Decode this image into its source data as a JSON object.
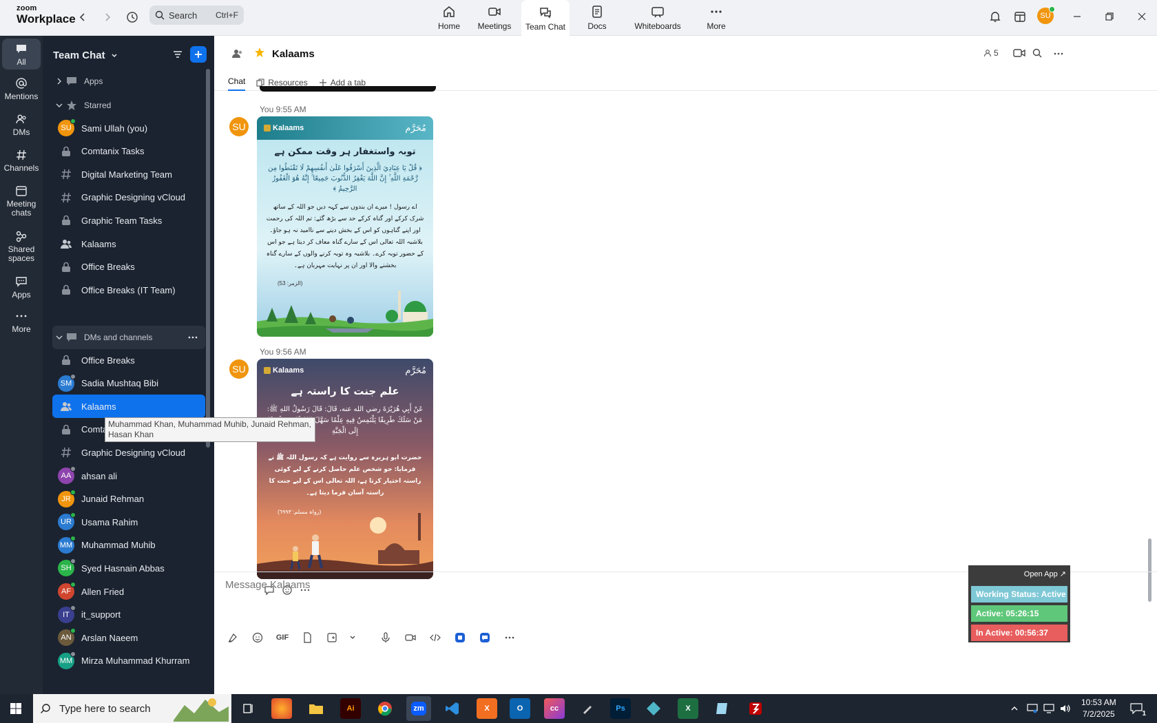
{
  "app": {
    "logo_line1": "zoom",
    "logo_line2": "Workplace"
  },
  "search": {
    "placeholder": "Search",
    "shortcut": "Ctrl+F"
  },
  "top_tabs": [
    {
      "label": "Home",
      "icon": "home-icon"
    },
    {
      "label": "Meetings",
      "icon": "video-icon"
    },
    {
      "label": "Team Chat",
      "icon": "chat-icon",
      "active": true
    },
    {
      "label": "Docs",
      "icon": "doc-icon"
    },
    {
      "label": "Whiteboards",
      "icon": "whiteboard-icon"
    },
    {
      "label": "More",
      "icon": "more-icon"
    }
  ],
  "top_right": {
    "avatar": "SU"
  },
  "rail": [
    {
      "label": "All",
      "icon": "chat-bubble-icon",
      "active": true
    },
    {
      "label": "Mentions",
      "icon": "at-icon"
    },
    {
      "label": "DMs",
      "icon": "people-icon"
    },
    {
      "label": "Channels",
      "icon": "hash-icon"
    },
    {
      "label": "Meeting chats",
      "icon": "calendar-icon"
    },
    {
      "label": "Shared spaces",
      "icon": "spaces-icon"
    },
    {
      "label": "Apps",
      "icon": "apps-icon"
    },
    {
      "label": "More",
      "icon": "ellipsis-icon"
    }
  ],
  "sidebar": {
    "title": "Team Chat",
    "apps_label": "Apps",
    "starred_label": "Starred",
    "starred": [
      {
        "label": "Sami Ullah (you)",
        "type": "avatar",
        "initials": "SU",
        "color": "#f0950d",
        "dot": "#2bb44a"
      },
      {
        "label": "Comtanix Tasks",
        "type": "lock"
      },
      {
        "label": "Digital Marketing Team",
        "type": "hash"
      },
      {
        "label": "Graphic Designing vCloud",
        "type": "hash"
      },
      {
        "label": "Graphic Team Tasks",
        "type": "lock"
      },
      {
        "label": "Kalaams",
        "type": "group"
      },
      {
        "label": "Office Breaks",
        "type": "lock"
      },
      {
        "label": "Office Breaks (IT Team)",
        "type": "lock"
      }
    ],
    "dm_label": "DMs and channels",
    "dms": [
      {
        "label": "Office Breaks",
        "type": "lock"
      },
      {
        "label": "Sadia Mushtaq Bibi",
        "type": "avatar",
        "initials": "SM",
        "color": "#2b7bd1",
        "dot": "#8a8f98"
      },
      {
        "label": "Kalaams",
        "type": "group",
        "active": true
      },
      {
        "label": "Comtanix Tasks",
        "type": "lock"
      },
      {
        "label": "Graphic Designing vCloud",
        "type": "hash"
      },
      {
        "label": "ahsan ali",
        "type": "avatar",
        "initials": "AA",
        "color": "#8e44ad",
        "dot": "#8a8f98"
      },
      {
        "label": "Junaid Rehman",
        "type": "avatar",
        "initials": "JR",
        "color": "#f0950d",
        "dot": "#2bb44a"
      },
      {
        "label": "Usama Rahim",
        "type": "avatar",
        "initials": "UR",
        "color": "#2b7bd1",
        "dot": "#2bb44a"
      },
      {
        "label": "Muhammad Muhib",
        "type": "avatar",
        "initials": "MM",
        "color": "#2b7bd1",
        "dot": "#2bb44a"
      },
      {
        "label": "Syed Hasnain Abbas",
        "type": "avatar",
        "initials": "SH",
        "color": "#2bb44a",
        "dot": "#8a8f98"
      },
      {
        "label": "Allen Fried",
        "type": "avatar",
        "initials": "AF",
        "color": "#d0452f",
        "dot": "#2bb44a"
      },
      {
        "label": "it_support",
        "type": "avatar",
        "initials": "IT",
        "color": "#3a3f8f",
        "dot": "#8a8f98"
      },
      {
        "label": "Arslan Naeem",
        "type": "avatar",
        "initials": "AN",
        "color": "#6b5a3c",
        "dot": "#2bb44a"
      },
      {
        "label": "Mirza Muhammad Khurram",
        "type": "avatar",
        "initials": "MM",
        "color": "#16a085",
        "dot": "#8a8f98"
      }
    ],
    "tooltip": "Muhammad Khan, Muhammad Muhib, Junaid Rehman, Hasan Khan"
  },
  "channel": {
    "title": "Kalaams",
    "tabs": [
      "Chat",
      "Resources",
      "Add a tab"
    ],
    "member_count": "5"
  },
  "messages": [
    {
      "meta": "You 9:55 AM",
      "avatar": "SU",
      "card": {
        "brand": "Kalaams",
        "badge": "مُحَرَّم",
        "title": "توبہ واستغفار ہر وقت ممکن ہے",
        "arabic": "﴿ قُلْ يَا عِبَادِيَ الَّذِينَ أَسْرَفُوا عَلَىٰ أَنفُسِهِمْ لَا تَقْنَطُوا مِن رَّحْمَةِ اللَّهِ ۚ إِنَّ اللَّهَ يَغْفِرُ الذُّنُوبَ جَمِيعًا ۚ إِنَّهُ هُوَ الْغَفُورُ الرَّحِيمُ ﴾",
        "urdu": "اے رسول ! میرے ان بندوں سے کہہ دیں جو اللہ کے ساتھ شرک کرکے اور گناہ کرکے حد سے بڑھ گئے: تم اللہ کی رحمت اور اپنے گناہوں کو اس کے بخش دینے سے ناامید نہ ہو جاؤ۔ بلاشبہ اللہ تعالی اس کے سارے گناہ معاف کر دیتا ہے جو اس کے حضور توبہ کرے۔ بلاشبہ وہ توبہ کرنے والوں کے سارے گناہ بخشنے والا اور ان پر نہایت مہربان ہے۔",
        "ref": "(الزمر: 53)"
      }
    },
    {
      "meta": "You 9:56 AM",
      "avatar": "SU",
      "card": {
        "brand": "Kalaams",
        "badge": "مُحَرَّم",
        "title": "علم جنت کا راستہ ہے",
        "arabic": "عَنْ أَبِي هُرَيْرَةَ رضي الله عنه، قَالَ: قَالَ رَسُولُ اللهِ ﷺ: مَنْ سَلَكَ طَرِيقًا يَلْتَمِسُ فِيهِ عِلْمًا سَهَّلَ اللهُ لَهُ بِهِ طَرِيقًا إِلَى الْجَنَّةِ",
        "urdu": "حضرت ابو ہریرہ سے روایت ہے کہ رسول اللہ ﷺ نے فرمایا: جو شخص علم حاصل کرنے کے لیے کوئی راستہ اختیار کرتا ہے، اللہ تعالی اس کے لیے جنت کا راستہ آسان فرما دیتا ہے۔",
        "ref": "(رواہ مسلم: ٦٩٩٣)"
      }
    }
  ],
  "composer": {
    "placeholder": "Message Kalaams",
    "gif": "GIF"
  },
  "status_widget": {
    "open_label": "Open App ↗",
    "working_status": "Working Status: Active",
    "active": "Active: 05:26:15",
    "inactive": "In Active: 00:56:37",
    "colors": {
      "working": "#7fc8d6",
      "active": "#5fc77a",
      "inactive": "#e85d5d"
    }
  },
  "taskbar": {
    "search_placeholder": "Type here to search",
    "time": "10:53 AM",
    "date": "7/2/2025",
    "notifications": "1"
  },
  "colors": {
    "accent": "#0e72ed",
    "sidebar_bg": "#1b2330",
    "rail_bg": "#222a35"
  }
}
